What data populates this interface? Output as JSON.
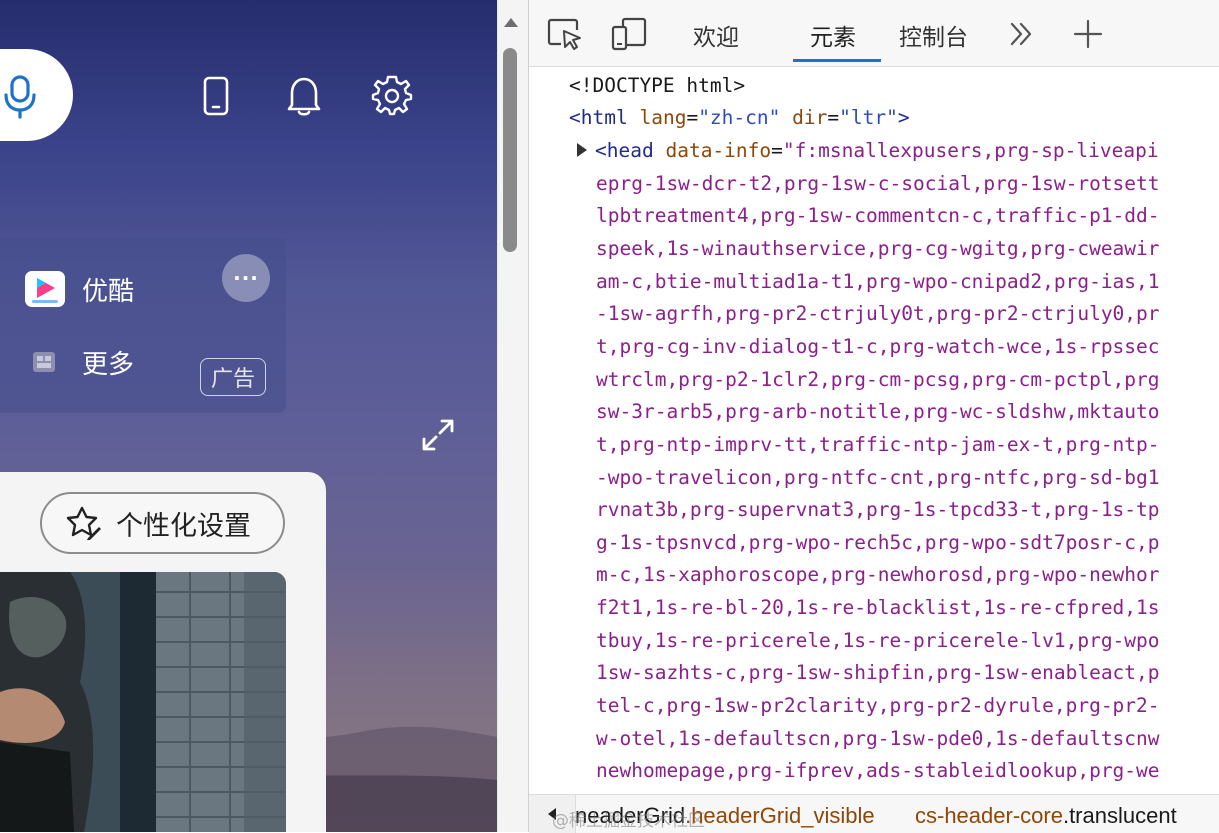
{
  "left": {
    "apps": [
      {
        "label": "优酷"
      },
      {
        "label": "更多"
      }
    ],
    "more_dots": "···",
    "ad_label": "广告",
    "personalize_label": "个性化设置"
  },
  "devtools": {
    "tabs": [
      "欢迎",
      "元素",
      "控制台"
    ],
    "active_tab": "元素",
    "code": {
      "doctype": "<!DOCTYPE html>",
      "html_tag": "html",
      "html_attrs": [
        {
          "name": "lang",
          "value": "\"zh-cn\""
        },
        {
          "name": "dir",
          "value": "\"ltr\""
        }
      ],
      "head_tag": "head",
      "head_attr": "data-info",
      "head_value_lines": [
        "\"f:msnallexpusers,prg-sp-liveapi",
        "eprg-1sw-dcr-t2,prg-1sw-c-social,prg-1sw-rotsett",
        "lpbtreatment4,prg-1sw-commentcn-c,traffic-p1-dd-",
        "speek,1s-winauthservice,prg-cg-wgitg,prg-cweawir",
        "am-c,btie-multiad1a-t1,prg-wpo-cnipad2,prg-ias,1",
        "-1sw-agrfh,prg-pr2-ctrjuly0t,prg-pr2-ctrjuly0,pr",
        "t,prg-cg-inv-dialog-t1-c,prg-watch-wce,1s-rpssec",
        "wtrclm,prg-p2-1clr2,prg-cm-pcsg,prg-cm-pctpl,prg",
        "sw-3r-arb5,prg-arb-notitle,prg-wc-sldshw,mktauto",
        "t,prg-ntp-imprv-tt,traffic-ntp-jam-ex-t,prg-ntp-",
        "-wpo-travelicon,prg-ntfc-cnt,prg-ntfc,prg-sd-bg1",
        "rvnat3b,prg-supervnat3,prg-1s-tpcd33-t,prg-1s-tp",
        "g-1s-tpsnvcd,prg-wpo-rech5c,prg-wpo-sdt7posr-c,p",
        "m-c,1s-xaphoroscope,prg-newhorosd,prg-wpo-newhor",
        "f2t1,1s-re-bl-20,1s-re-blacklist,1s-re-cfpred,1s",
        "tbuy,1s-re-pricerele,1s-re-pricerele-lv1,prg-wpo",
        "1sw-sazhts-c,prg-1sw-shipfin,prg-1sw-enableact,p",
        "tel-c,prg-1sw-pr2clarity,prg-pr2-dyrule,prg-pr2-",
        "w-otel,1s-defaultscn,prg-1sw-pde0,1s-defaultscnw",
        "newhomepage,prg-ifprev,ads-stableidlookup,prg-we"
      ]
    },
    "breadcrumb": {
      "first": "neaderGrid",
      "first_class": ".headerGrid_visible",
      "second": "cs-header-core",
      "second_class": ".translucent"
    },
    "watermark": "@稀土掘金技术社区"
  }
}
